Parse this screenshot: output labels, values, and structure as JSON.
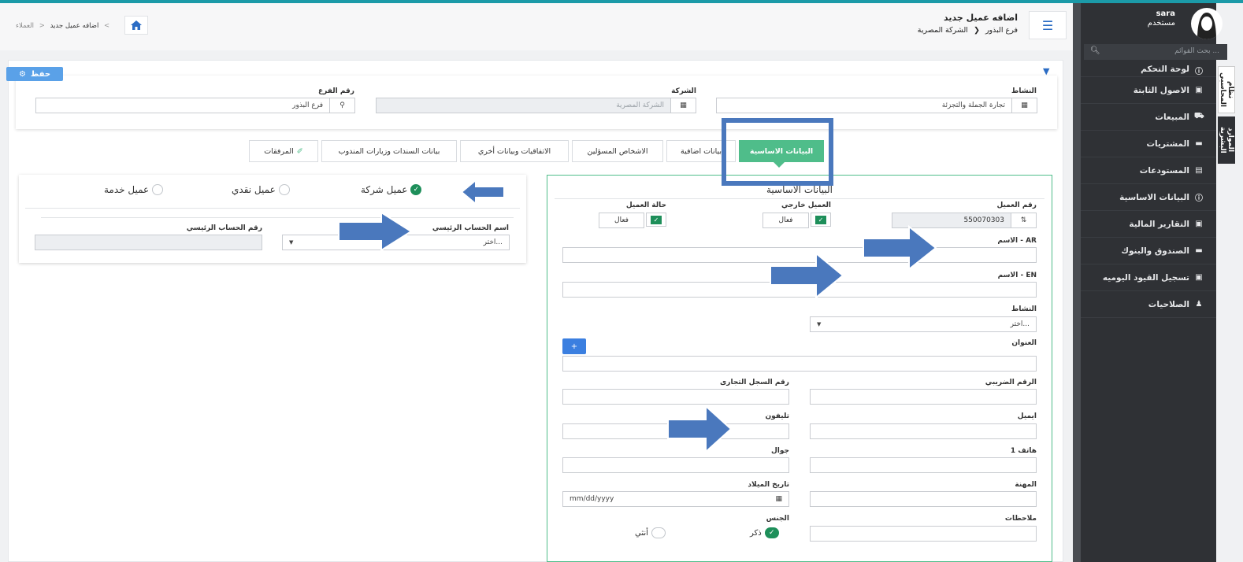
{
  "sidebar": {
    "user_name": "sara",
    "user_role": "مستخدم",
    "search_placeholder": "بحث القوائم ...",
    "items": [
      {
        "label": "لوحة التحكم",
        "icon": "info-icon"
      },
      {
        "label": "الاصول الثابتة",
        "icon": "file-icon"
      },
      {
        "label": "المبيعات",
        "icon": "truck-icon"
      },
      {
        "label": "المشتريات",
        "icon": "card-icon"
      },
      {
        "label": "المستودعات",
        "icon": "box-icon"
      },
      {
        "label": "البيانات الاساسية",
        "icon": "info-icon"
      },
      {
        "label": "التقارير المالية",
        "icon": "file-icon"
      },
      {
        "label": "الصندوق والبنوك",
        "icon": "card-icon"
      },
      {
        "label": "تسجيل القيود اليوميه",
        "icon": "file-icon"
      },
      {
        "label": "الصلاحيات",
        "icon": "users-icon"
      }
    ],
    "vtabs": [
      "نظام المحاسبي",
      "الموارد البشرية"
    ]
  },
  "header": {
    "title": "اضافه عميل جديد",
    "company": "الشركة المصرية",
    "branch": "فرع البذور",
    "breadcrumb": [
      "العملاء",
      "اضافه عميل جديد"
    ]
  },
  "toolbar": {
    "save_label": "حفظ"
  },
  "top_fields": {
    "activity_label": "النشاط",
    "activity_value": "تجارة الجملة والتجزئة",
    "company_label": "الشركة",
    "company_value": "الشركة المصرية",
    "branch_label": "رقم الفرع",
    "branch_value": "فرع البذور"
  },
  "tabs": [
    "البيانات الاساسية",
    "بيانات اضافية",
    "الاشخاص المسؤلين",
    "الاتفاقيات وبيانات أخري",
    "بيانات السندات وزيارات المندوب",
    "المرفقات"
  ],
  "client_type": {
    "options": [
      "عميل شركة",
      "عميل نقدي",
      "عميل خدمة"
    ],
    "selected": "عميل شركة",
    "main_account_name_label": "اسم الحساب الرئيسي",
    "main_account_name_placeholder": "اختر...",
    "main_account_number_label": "رقم الحساب الرئيسي"
  },
  "basic": {
    "title": "البيانات الاساسية",
    "client_number_label": "رقم العميل",
    "client_number_value": "550070303",
    "external_label": "العميل خارجي",
    "status_label": "حالة العميل",
    "active_text": "فعال",
    "name_ar_label": "الاسم - AR",
    "name_en_label": "الاسم - EN",
    "activity_label": "النشاط",
    "activity_placeholder": "اختر...",
    "address_label": "العنوان",
    "tax_label": "الرقم الضريبي",
    "commercial_label": "رقم السجل التجارى",
    "email_label": "ايميل",
    "phone_label": "تليفون",
    "phone1_label": "1 هاتف",
    "mobile_label": "جوال",
    "job_label": "المهنة",
    "birth_label": "تاريخ الميلاد",
    "birth_placeholder": "mm/dd/yyyy",
    "notes_label": "ملاحظات",
    "gender_label": "الجنس",
    "male": "ذكر",
    "female": "أنثي"
  },
  "colors": {
    "accent": "#4fbd8a",
    "brand": "#2b6cc4",
    "sidebar": "#2f3135",
    "arrow": "#4a78bd"
  }
}
